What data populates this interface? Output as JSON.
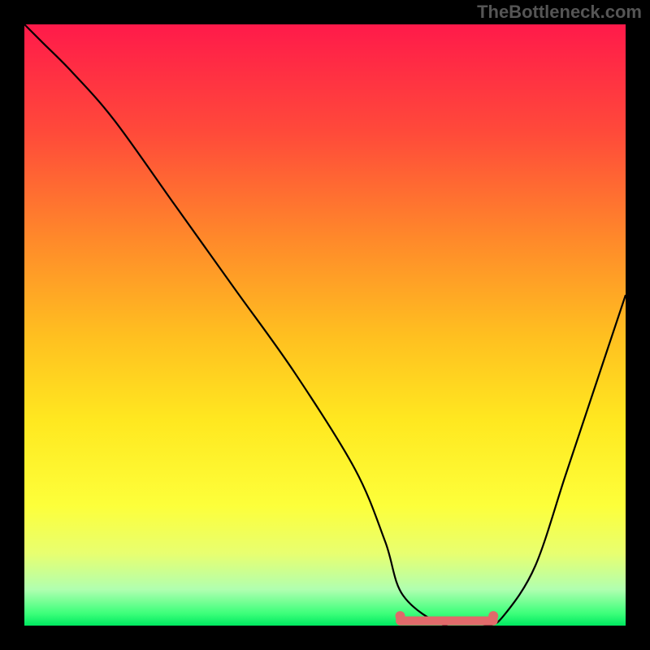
{
  "watermark": "TheBottleneck.com",
  "chart_data": {
    "type": "line",
    "title": "",
    "xlabel": "",
    "ylabel": "",
    "xlim": [
      0,
      100
    ],
    "ylim": [
      0,
      100
    ],
    "series": [
      {
        "name": "bottleneck-curve",
        "x": [
          0,
          3,
          8,
          15,
          25,
          35,
          45,
          55,
          60,
          63,
          70,
          77,
          80,
          85,
          90,
          95,
          100
        ],
        "values": [
          100,
          97,
          92,
          84,
          70,
          56,
          42,
          26,
          14,
          5,
          0,
          0,
          2,
          10,
          25,
          40,
          55
        ]
      }
    ],
    "annotations": [
      {
        "name": "optimal-range-bump",
        "x_start": 62.5,
        "x_end": 78,
        "y": 0.8,
        "color": "#e06a6a"
      }
    ],
    "background_gradient": {
      "top": "#ff1a4a",
      "mid": "#ffe820",
      "bottom": "#00e860"
    }
  }
}
